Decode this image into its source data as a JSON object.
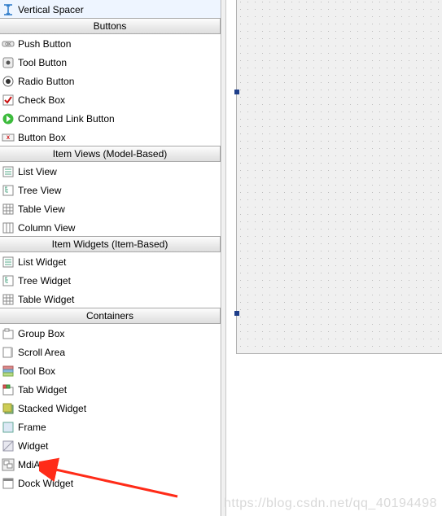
{
  "categories": [
    {
      "header": null,
      "items": [
        {
          "icon": "vertical-spacer-icon",
          "label": "Vertical Spacer"
        }
      ]
    },
    {
      "header": "Buttons",
      "items": [
        {
          "icon": "push-button-icon",
          "label": "Push Button"
        },
        {
          "icon": "tool-button-icon",
          "label": "Tool Button"
        },
        {
          "icon": "radio-button-icon",
          "label": "Radio Button"
        },
        {
          "icon": "check-box-icon",
          "label": "Check Box"
        },
        {
          "icon": "command-link-icon",
          "label": "Command Link Button"
        },
        {
          "icon": "button-box-icon",
          "label": "Button Box"
        }
      ]
    },
    {
      "header": "Item Views (Model-Based)",
      "items": [
        {
          "icon": "list-view-icon",
          "label": "List View"
        },
        {
          "icon": "tree-view-icon",
          "label": "Tree View"
        },
        {
          "icon": "table-view-icon",
          "label": "Table View"
        },
        {
          "icon": "column-view-icon",
          "label": "Column View"
        }
      ]
    },
    {
      "header": "Item Widgets (Item-Based)",
      "items": [
        {
          "icon": "list-widget-icon",
          "label": "List Widget"
        },
        {
          "icon": "tree-widget-icon",
          "label": "Tree Widget"
        },
        {
          "icon": "table-widget-icon",
          "label": "Table Widget"
        }
      ]
    },
    {
      "header": "Containers",
      "items": [
        {
          "icon": "group-box-icon",
          "label": "Group Box"
        },
        {
          "icon": "scroll-area-icon",
          "label": "Scroll Area"
        },
        {
          "icon": "tool-box-icon",
          "label": "Tool Box"
        },
        {
          "icon": "tab-widget-icon",
          "label": "Tab Widget"
        },
        {
          "icon": "stacked-widget-icon",
          "label": "Stacked Widget"
        },
        {
          "icon": "frame-icon",
          "label": "Frame"
        },
        {
          "icon": "widget-icon",
          "label": "Widget"
        },
        {
          "icon": "mdi-area-icon",
          "label": "MdiArea"
        },
        {
          "icon": "dock-widget-icon",
          "label": "Dock Widget"
        }
      ]
    }
  ],
  "watermark": "https://blog.csdn.net/qq_40194498",
  "arrow_color": "#ff2b18"
}
